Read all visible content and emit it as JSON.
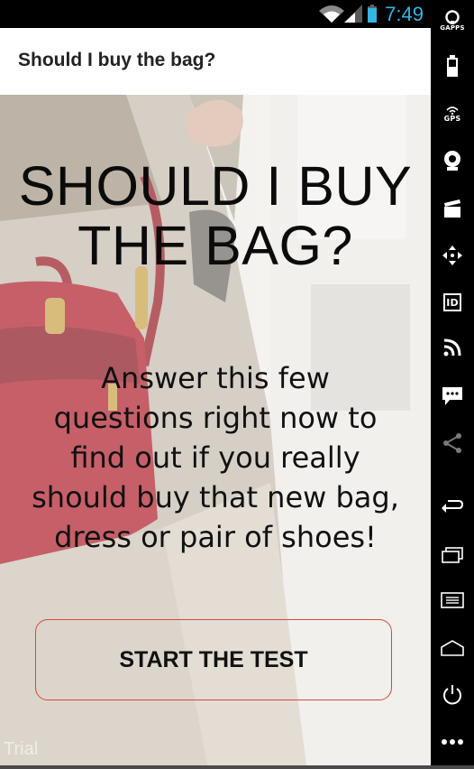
{
  "status_bar": {
    "time": "7:49",
    "time_color": "#33b5e5",
    "icons": [
      "wifi-icon",
      "signal-icon",
      "battery-icon"
    ]
  },
  "app_bar": {
    "title": "Should I buy the bag?"
  },
  "hero": {
    "title_line1": "SHOULD I BUY",
    "title_line2": "THE BAG?",
    "subtitle_lines": [
      "Answer this few",
      "questions right now to",
      "find out if you really",
      "should buy that new bag,",
      "dress or pair of shoes!"
    ]
  },
  "start_button": {
    "label": "START THE TEST",
    "border_color": "#d8483e"
  },
  "watermark": "Trial",
  "sidebar": {
    "gapps_label": "GAPPS",
    "gps_label": "GPS",
    "id_label": "ID",
    "items": [
      "gapps-icon",
      "battery-icon",
      "gps-icon",
      "camera-icon",
      "clapper-icon",
      "move-icon",
      "id-icon",
      "rss-icon",
      "chat-icon",
      "share-icon",
      "back-icon",
      "recent-apps-icon",
      "menu-icon",
      "home-icon",
      "power-icon",
      "more-icon"
    ]
  }
}
